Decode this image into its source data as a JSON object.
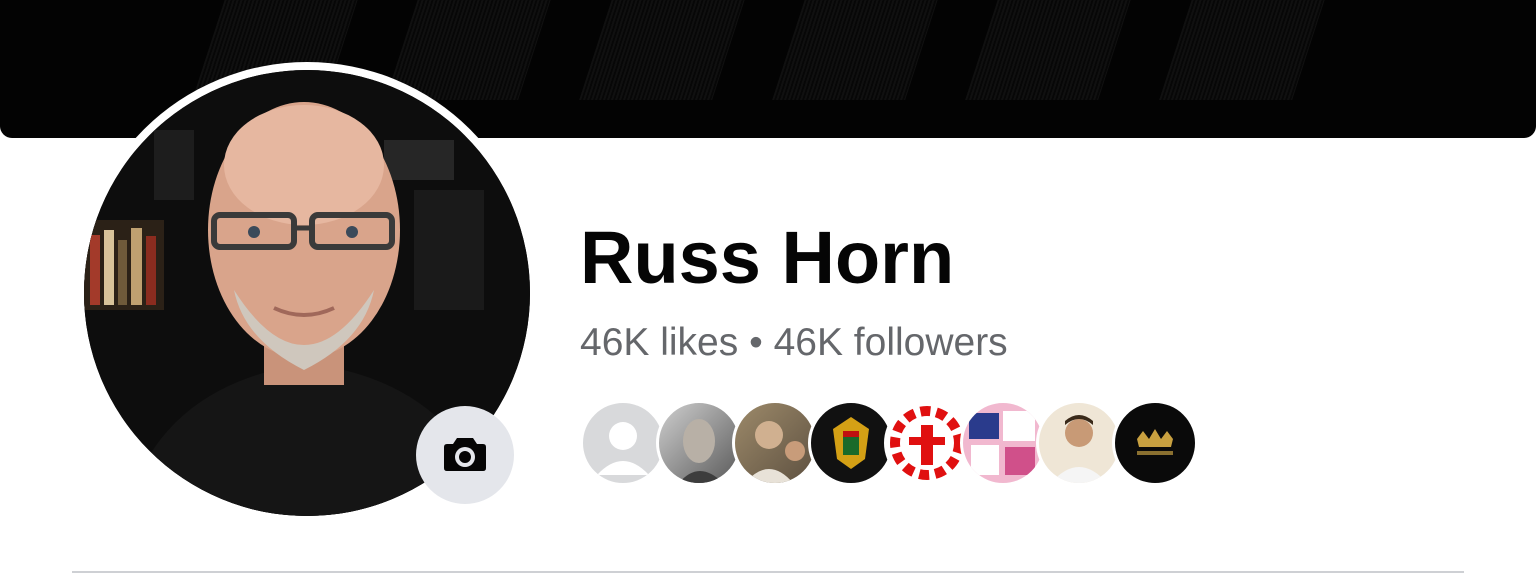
{
  "profile": {
    "name": "Russ Horn",
    "stats": "46K likes • 46K followers"
  },
  "icons": {
    "camera": "camera-icon",
    "default_avatar": "person-silhouette-icon"
  },
  "followers": [
    {
      "name": "follower-avatar-default",
      "color": "#d9d9d9"
    },
    {
      "name": "follower-avatar-sketch",
      "color": "#7a7a7a"
    },
    {
      "name": "follower-avatar-photo",
      "color": "#8a7a62"
    },
    {
      "name": "follower-avatar-emblem",
      "color": "#1a1a1a"
    },
    {
      "name": "follower-avatar-red-logo",
      "color": "#e01010"
    },
    {
      "name": "follower-avatar-collage",
      "color": "#e9a6c4"
    },
    {
      "name": "follower-avatar-portrait",
      "color": "#d7c2a6"
    },
    {
      "name": "follower-avatar-crown-logo",
      "color": "#0b0b0b"
    }
  ],
  "colors": {
    "name_text": "#050505",
    "secondary_text": "#65676b",
    "camera_button_bg": "#e4e6eb",
    "cover_bg": "#030303"
  }
}
